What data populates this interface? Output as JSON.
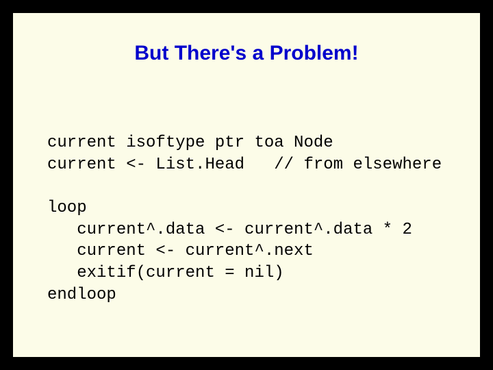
{
  "slide": {
    "title": "But There's a Problem!",
    "code": "current isoftype ptr toa Node\ncurrent <- List.Head   // from elsewhere\n\nloop\n   current^.data <- current^.data * 2\n   current <- current^.next\n   exitif(current = nil)\nendloop"
  }
}
